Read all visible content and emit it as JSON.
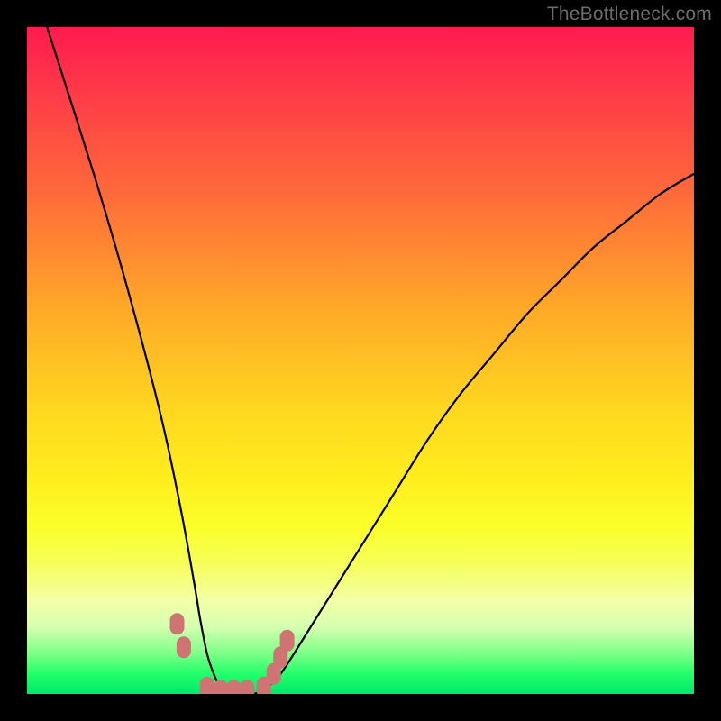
{
  "watermark": "TheBottleneck.com",
  "chart_data": {
    "type": "line",
    "title": "",
    "xlabel": "",
    "ylabel": "",
    "xlim": [
      0,
      100
    ],
    "ylim": [
      0,
      100
    ],
    "series": [
      {
        "name": "bottleneck-curve",
        "x": [
          3,
          10,
          15,
          20,
          23,
          25,
          26,
          27,
          28,
          29,
          30,
          32,
          34,
          36,
          38,
          40,
          45,
          50,
          55,
          60,
          65,
          70,
          75,
          80,
          85,
          90,
          95,
          100
        ],
        "y": [
          100,
          78,
          61,
          42,
          28,
          17,
          11,
          6,
          3,
          1,
          0,
          0,
          0,
          1,
          3,
          6,
          14,
          22,
          30,
          38,
          45,
          51,
          57,
          62,
          67,
          71,
          75,
          78
        ]
      }
    ],
    "markers": [
      {
        "x": 22.5,
        "y": 10.5
      },
      {
        "x": 23.5,
        "y": 7.0
      },
      {
        "x": 27.0,
        "y": 1.0
      },
      {
        "x": 29.0,
        "y": 0.5
      },
      {
        "x": 31.0,
        "y": 0.5
      },
      {
        "x": 33.0,
        "y": 0.5
      },
      {
        "x": 35.5,
        "y": 1.0
      },
      {
        "x": 37.0,
        "y": 3.0
      },
      {
        "x": 38.0,
        "y": 5.5
      },
      {
        "x": 39.0,
        "y": 8.0
      }
    ],
    "marker_color": "#cf7373",
    "curve_color": "#000000",
    "gradient_stops": [
      {
        "pos": 0,
        "color": "#ff1a4f"
      },
      {
        "pos": 25,
        "color": "#ff6a3a"
      },
      {
        "pos": 58,
        "color": "#ffd91f"
      },
      {
        "pos": 80,
        "color": "#f7ff54"
      },
      {
        "pos": 94,
        "color": "#7bff88"
      },
      {
        "pos": 100,
        "color": "#00e86b"
      }
    ]
  }
}
